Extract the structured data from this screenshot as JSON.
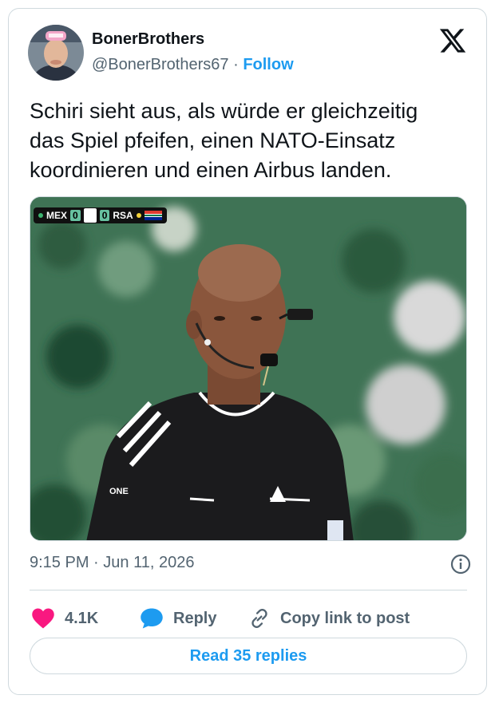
{
  "author": {
    "display_name": "BonerBrothers",
    "handle": "@BonerBrothers67",
    "separator": "·",
    "follow_label": "Follow"
  },
  "tweet": {
    "text": "Schiri sieht aus, als würde er gleichzeitig\ndas Spiel pfeifen, einen NATO-Einsatz\nkoordinieren und einen Airbus landen."
  },
  "media": {
    "scorebug": {
      "team_home": "MEX",
      "score_home": "0",
      "score_away": "0",
      "team_away": "RSA"
    },
    "sleeve_text": "ONE"
  },
  "meta": {
    "time": "9:15 PM",
    "separator": "·",
    "date": "Jun 11, 2026"
  },
  "actions": {
    "likes_count": "4.1K",
    "reply_label": "Reply",
    "copy_label": "Copy link to post"
  },
  "read_replies_label": "Read 35 replies",
  "icons": [
    "x-logo-icon",
    "info-icon",
    "heart-icon",
    "reply-bubble-icon",
    "link-icon"
  ],
  "colors": {
    "accent": "#1d9bf0",
    "like": "#f91880",
    "text_primary": "#0f1419",
    "text_secondary": "#536471",
    "border": "#cfd9de"
  }
}
